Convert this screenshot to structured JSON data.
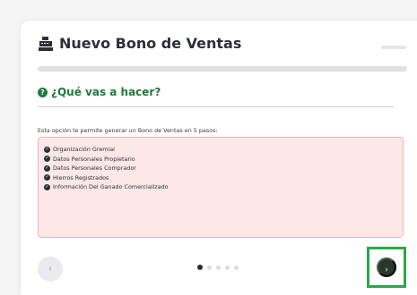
{
  "header": {
    "title": "Nuevo Bono de Ventas",
    "icon": "cash-register-icon"
  },
  "section": {
    "title": "¿Qué vas a hacer?",
    "icon": "question-circle-icon",
    "accent": "#1f7a3b"
  },
  "intro": "Esta opción te permite generar un Bono de Ventas en 5 pasos:",
  "steps": [
    {
      "label": "Organización Gremial"
    },
    {
      "label": "Datos Personales Propietario"
    },
    {
      "label": "Datos Personales Comprador"
    },
    {
      "label": "Hierros Registrados"
    },
    {
      "label": "Información Del Ganado Comercializado"
    }
  ],
  "pagination": {
    "total": 5,
    "current": 1
  },
  "nav": {
    "prev_glyph": "‹",
    "next_glyph": "›"
  },
  "colors": {
    "steps_bg": "#fde7e7",
    "steps_border": "#f2b5b5",
    "next_bg": "#24382b",
    "highlight": "#2ba846"
  }
}
